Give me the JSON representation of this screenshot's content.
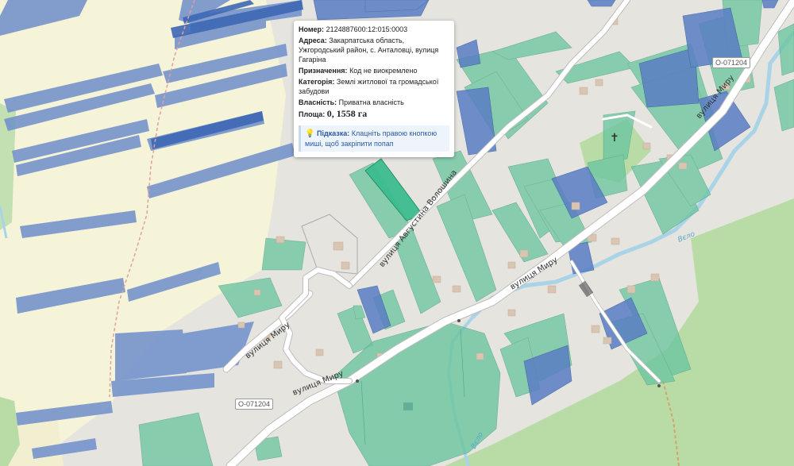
{
  "popup": {
    "number_label": "Номер:",
    "number_value": "2124887600:12:015:0003",
    "address_label": "Адреса:",
    "address_value": "Закарпатська область, Ужгородський район, с. Анталовці, вулиця Гагаріна",
    "purpose_label": "Призначення:",
    "purpose_value": "Код не виокремлено",
    "category_label": "Категорія:",
    "category_value": "Землі житлової та громадської забудови",
    "ownership_label": "Власність:",
    "ownership_value": "Приватна власність",
    "area_label": "Площа:",
    "area_value": "0, 1558 га",
    "hint_label": "Підказка:",
    "hint_text": "Клацніть правою кнопкою миші, щоб закріпити попап"
  },
  "map": {
    "road_labels": [
      "вулиця Августина Волошина",
      "вулиця Миру",
      "вулиця Миру",
      "вулиця Миру",
      "вулиця Миру"
    ],
    "road_shields": [
      "O-071204",
      "O-071204"
    ],
    "river_labels": [
      "Вєло",
      "Вєло"
    ],
    "colors": {
      "background": "#e6e4df",
      "farmland": "#f5f3d8",
      "forest": "#b9dca6",
      "parcel_green": "#6cc6a0",
      "parcel_blue": "#5a7ec4",
      "selected_parcel": "#3dbd8f",
      "road": "#ffffff",
      "river": "#a9d3e6"
    }
  }
}
